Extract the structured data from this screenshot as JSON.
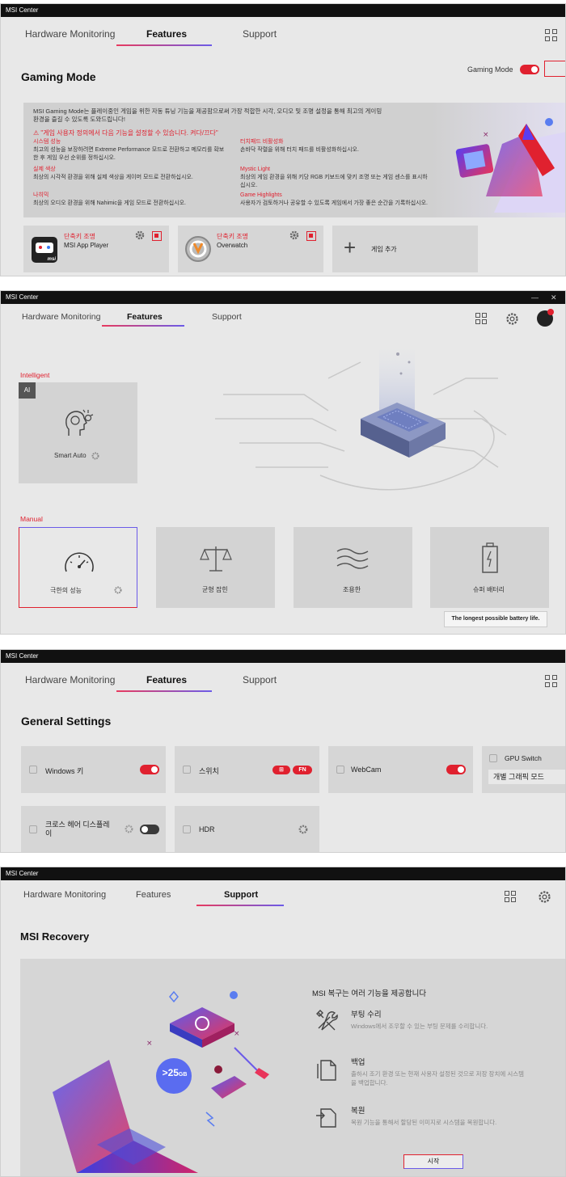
{
  "app_title": "MSI Center",
  "tabs": {
    "hardware": "Hardware Monitoring",
    "features": "Features",
    "support": "Support"
  },
  "colors": {
    "accent_red": "#e0212f",
    "accent_purple": "#6b5be8"
  },
  "gaming": {
    "page_title": "Gaming Mode",
    "toggle_label": "Gaming Mode",
    "toggle_on": true,
    "banner": {
      "intro_line1": "MSI Gaming Mode는 플레이중인 게임을 위한 자동 튜닝 기능을 제공함으로써 가장 적합한 시각, 오디오 및 조명 설정을 통해 최고의 게이밍",
      "intro_line2": "환경을 즐길 수 있도록 도와드립니다!",
      "warning": "\"게임 사용자 정의에서 다음 기능을 설정할 수 있습니다. 켜다/끄다\"",
      "items": [
        {
          "title": "시스템 성능",
          "desc1": "최고의 성능을 보장하려면 Extreme Performance 모드로 전환하고 메모리를 확보",
          "desc2": "한 후 게임 우선 순위를 정하십시오."
        },
        {
          "title": "터치패드 비활성화",
          "desc1": "손바닥 작렬을 위해 터치 패드를 비활성화하십시오.",
          "desc2": ""
        },
        {
          "title": "실제 색상",
          "desc1": "최상의 시각적 환경을 위해 실제 색상을 게이머 모드로 전환하십시오.",
          "desc2": ""
        },
        {
          "title": "Mystic Light",
          "desc1": "최상의 게임 환경을 위해 키당 RGB 키보드에 맞키 조명 또는 게임 센스를 표시하",
          "desc2": "십시오."
        },
        {
          "title": "나히믹",
          "desc1": "최상의 오디오 환경을 위해 Nahimic을 게임 모드로 전환하십시오.",
          "desc2": ""
        },
        {
          "title": "Game Highlights",
          "desc1": "사용자가 검토하거나 공유할 수 있도록 게임에서 가장 좋은 순간을 기록하십시오.",
          "desc2": ""
        }
      ]
    },
    "games": [
      {
        "shortcut": "단축키 조명",
        "name": "MSI App Player"
      },
      {
        "shortcut": "단축키 조명",
        "name": "Overwatch"
      }
    ],
    "add_game": "게임 추가",
    "app_logo_text": "msi"
  },
  "features": {
    "intelligent_label": "Intelligent",
    "ai_badge": "AI",
    "smart_auto": "Smart Auto",
    "manual_label": "Manual",
    "modes": [
      "극한의 성능",
      "균형 잡힌",
      "조용한",
      "슈퍼 배터리"
    ],
    "tooltip": "The longest possible battery life."
  },
  "general": {
    "page_title": "General Settings",
    "windows_key": "Windows 키",
    "switch": "스위치",
    "switch_pills": [
      "⊞",
      "FN"
    ],
    "webcam": "WebCam",
    "gpu_switch": "GPU Switch",
    "gpu_mode": "개별 그래픽 모드",
    "crosshair_line1": "크로스 헤어 디스플레",
    "crosshair_line2": "이",
    "hdr": "HDR"
  },
  "recovery": {
    "page_title": "MSI Recovery",
    "intro": "MSI 복구는 여러 기능을 제공합니다",
    "items": [
      {
        "title": "부팅 수리",
        "desc1": "Windows에서 조우할 수 있는 부팅 문제를 수리합니다.",
        "desc2": ""
      },
      {
        "title": "백업",
        "desc1": "출하시 조기 환경 또는 현재 사용자 설정된 것으로 저장 장치에 시스템",
        "desc2": "을 백업합니다."
      },
      {
        "title": "복원",
        "desc1": "복원 기능을 통해서 할당된 이미지로 시스템을 복원합니다.",
        "desc2": ""
      }
    ],
    "start_button": "시작",
    "disk_badge": ">25",
    "disk_unit": "GB"
  }
}
